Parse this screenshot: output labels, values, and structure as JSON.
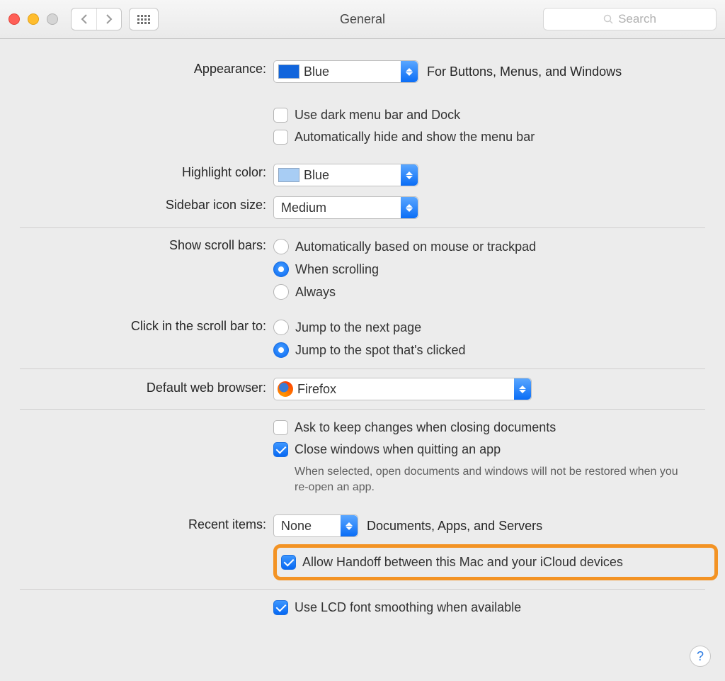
{
  "window": {
    "title": "General",
    "search_placeholder": "Search"
  },
  "appearance": {
    "label": "Appearance:",
    "value": "Blue",
    "hint": "For Buttons, Menus, and Windows",
    "dark_menu_label": "Use dark menu bar and Dock",
    "auto_hide_label": "Automatically hide and show the menu bar"
  },
  "highlight": {
    "label": "Highlight color:",
    "value": "Blue"
  },
  "sidebar": {
    "label": "Sidebar icon size:",
    "value": "Medium"
  },
  "scroll": {
    "label": "Show scroll bars:",
    "opts": [
      "Automatically based on mouse or trackpad",
      "When scrolling",
      "Always"
    ]
  },
  "click_scroll": {
    "label": "Click in the scroll bar to:",
    "opts": [
      "Jump to the next page",
      "Jump to the spot that's clicked"
    ]
  },
  "browser": {
    "label": "Default web browser:",
    "value": "Firefox"
  },
  "docs": {
    "ask_label": "Ask to keep changes when closing documents",
    "close_label": "Close windows when quitting an app",
    "close_hint": "When selected, open documents and windows will not be restored when you re-open an app."
  },
  "recent": {
    "label": "Recent items:",
    "value": "None",
    "hint": "Documents, Apps, and Servers"
  },
  "handoff": {
    "label": "Allow Handoff between this Mac and your iCloud devices"
  },
  "lcd": {
    "label": "Use LCD font smoothing when available"
  },
  "help": "?"
}
